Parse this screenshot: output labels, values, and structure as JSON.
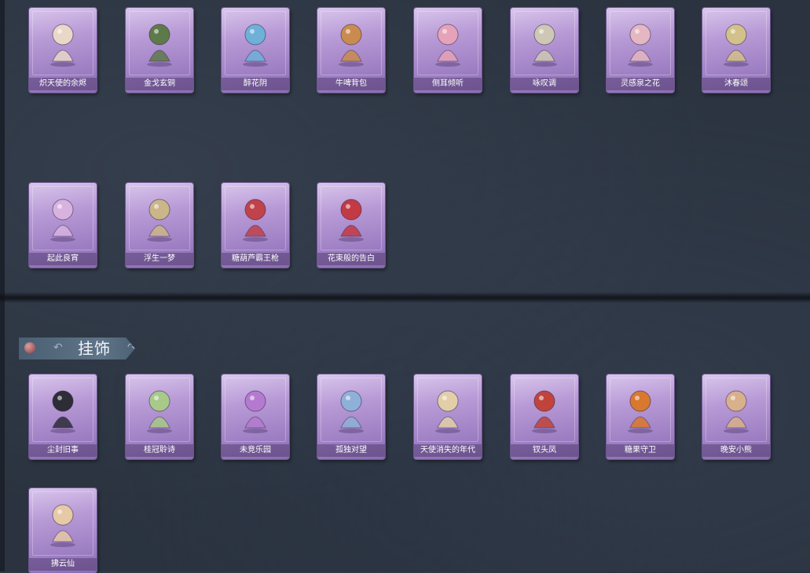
{
  "section_header": {
    "title": "挂饰"
  },
  "items": [
    {
      "name": "炽天使的余烬",
      "icon": "angel-figure-icon",
      "color": "#e9d8c8"
    },
    {
      "name": "金戈玄铜",
      "icon": "bronze-grenade-icon",
      "color": "#5f7a4a"
    },
    {
      "name": "醉花阴",
      "icon": "flower-ornament-icon",
      "color": "#6fb0d8"
    },
    {
      "name": "牛啤背包",
      "icon": "cow-backpack-icon",
      "color": "#c98b4f"
    },
    {
      "name": "侧耳倾听",
      "icon": "flower-harp-icon",
      "color": "#e6a2b8"
    },
    {
      "name": "咏叹调",
      "icon": "ornate-frame-icon",
      "color": "#cfc7b5"
    },
    {
      "name": "灵感泉之花",
      "icon": "flower-bouquet-icon",
      "color": "#e4b7c2"
    },
    {
      "name": "沐春颂",
      "icon": "spring-branch-icon",
      "color": "#d2c18a"
    },
    {
      "name": "起此良宵",
      "icon": "moon-fan-icon",
      "color": "#d8b3e0"
    },
    {
      "name": "浮生一梦",
      "icon": "scroll-icon",
      "color": "#cbb68a"
    },
    {
      "name": "糖葫芦霸王枪",
      "icon": "candied-spear-icon",
      "color": "#c0424a"
    },
    {
      "name": "花束般的告白",
      "icon": "rose-icon",
      "color": "#c23a44"
    },
    {
      "name": "尘封旧事",
      "icon": "chibi-gentleman-icon",
      "color": "#2d2d38"
    },
    {
      "name": "桂冠聆诗",
      "icon": "chibi-laurel-icon",
      "color": "#a8c98a"
    },
    {
      "name": "未竞乐园",
      "icon": "chibi-purple-girl-icon",
      "color": "#b47ad0"
    },
    {
      "name": "孤独对望",
      "icon": "chibi-blue-girl-icon",
      "color": "#8fb0d8"
    },
    {
      "name": "天使消失的年代",
      "icon": "chibi-angel-icon",
      "color": "#e2cfa8"
    },
    {
      "name": "钗头凤",
      "icon": "chibi-phoenix-crown-icon",
      "color": "#c0443c"
    },
    {
      "name": "糖果守卫",
      "icon": "pumpkin-charm-icon",
      "color": "#d9782f"
    },
    {
      "name": "晚安小熊",
      "icon": "bear-charm-icon",
      "color": "#d8b08c"
    },
    {
      "name": "拂云仙",
      "icon": "chibi-fairy-icon",
      "color": "#e6c9a6"
    }
  ]
}
